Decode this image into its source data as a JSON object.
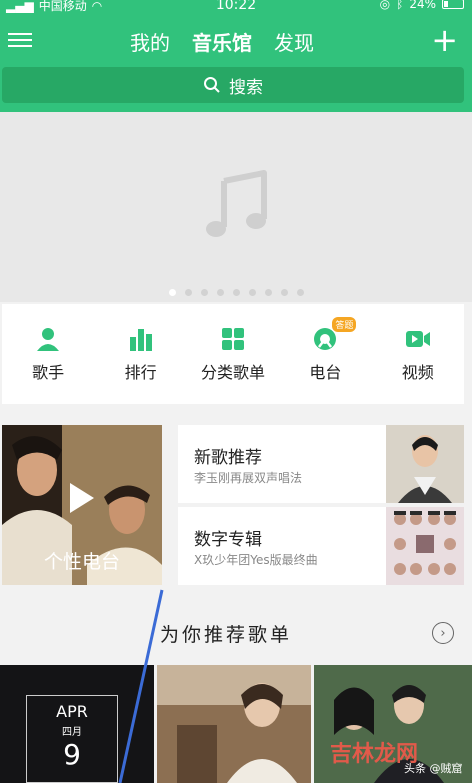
{
  "status": {
    "carrier": "中国移动",
    "time": "10:22",
    "battery": "24%"
  },
  "nav": {
    "tabs": [
      "我的",
      "音乐馆",
      "发现"
    ],
    "active_index": 1
  },
  "search": {
    "placeholder": "搜索"
  },
  "banner": {
    "page_count": 9,
    "active_page": 0
  },
  "categories": [
    {
      "label": "歌手",
      "icon": "singer-icon"
    },
    {
      "label": "排行",
      "icon": "chart-icon"
    },
    {
      "label": "分类歌单",
      "icon": "grid-icon"
    },
    {
      "label": "电台",
      "icon": "radio-icon",
      "badge": "答题"
    },
    {
      "label": "视频",
      "icon": "video-icon"
    }
  ],
  "radio_card": {
    "label": "个性电台"
  },
  "new_songs": {
    "title": "新歌推荐",
    "subtitle": "李玉刚再展双声唱法"
  },
  "digital_album": {
    "title": "数字专辑",
    "subtitle": "X玖少年团Yes版最终曲"
  },
  "recommend": {
    "title": "为你推荐歌单"
  },
  "playlist1": {
    "month": "APR",
    "month_cn": "四月",
    "day": "9"
  },
  "watermark": {
    "text": "吉林龙网",
    "sub": "头条 @贼窟"
  },
  "colors": {
    "brand_green": "#31c27c"
  }
}
